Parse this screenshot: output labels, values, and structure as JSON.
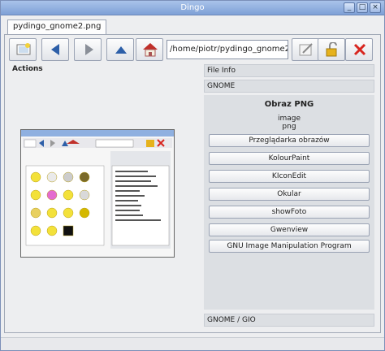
{
  "window": {
    "title": "Dingo"
  },
  "tab": {
    "label": "pydingo_gnome2.png"
  },
  "toolbar": {
    "path_value": "/home/piotr/pydingo_gnome2.png",
    "icons": [
      "new-image-icon",
      "back-arrow-icon",
      "forward-arrow-icon",
      "up-arrow-icon",
      "home-icon",
      "edit-icon",
      "unlock-icon",
      "close-icon"
    ]
  },
  "actions": {
    "label": "Actions"
  },
  "sections": {
    "file_info": "File Info",
    "gnome": "GNOME",
    "gnome_gio": "GNOME / GIO"
  },
  "panel": {
    "title": "Obraz PNG",
    "mime_main": "image",
    "mime_sub": "png",
    "apps": [
      "Przeglądarka obrazów",
      "KolourPaint",
      "KIconEdit",
      "Okular",
      "showFoto",
      "Gwenview",
      "GNU Image Manipulation Program"
    ]
  },
  "colors": {
    "titlebar": "#8fb0e0",
    "close_red": "#d8261f",
    "arrow_blue": "#2d5fa8"
  }
}
